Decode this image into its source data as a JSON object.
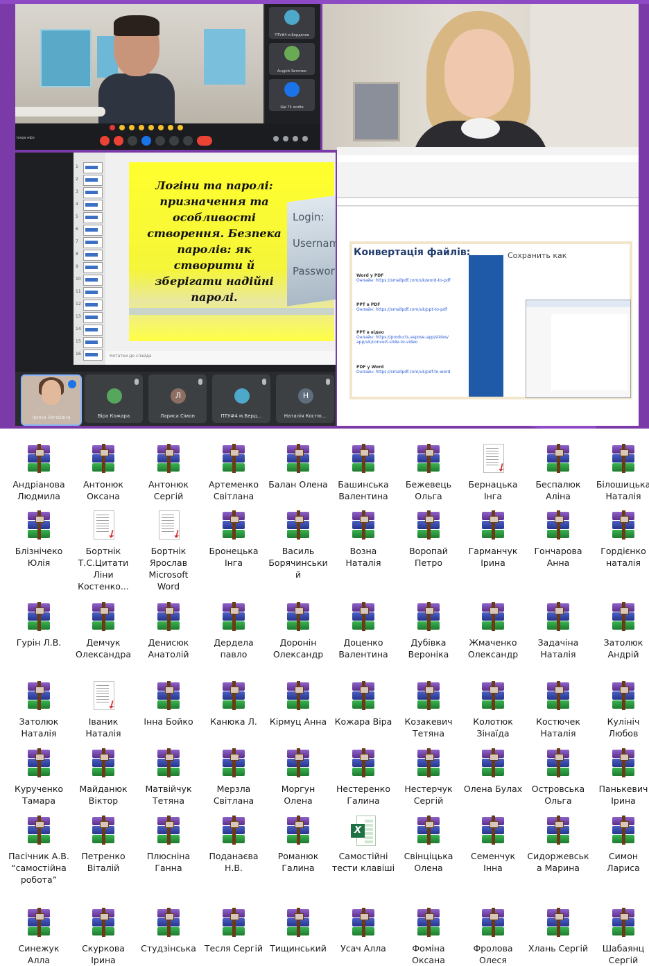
{
  "collage": {
    "video_call": {
      "thumbs": [
        {
          "label": "ПТУ#4 м.Бердичев",
          "color": "#4ea8c9"
        },
        {
          "label": "Андрій Затолюк",
          "color": "#6aaa55"
        },
        {
          "label": "Ще 74 особи",
          "color": "#1a73e8"
        }
      ],
      "meeting_label": "Іскра нфо",
      "emoji_count": 8
    },
    "slides": {
      "slide_text": "Логіни та паролі: призначення та особливості створення. Безпека паролів: як створити й зберігати надійні паролі.",
      "login_words": [
        "Login:",
        "Usernam",
        "Passwor"
      ],
      "notes_placeholder": "Нотатки до слайда",
      "thumb_numbers": [
        "1",
        "2",
        "3",
        "4",
        "5",
        "6",
        "7",
        "8",
        "9",
        "10",
        "11",
        "12",
        "13",
        "14",
        "15",
        "16"
      ],
      "participants": [
        {
          "name": "Ірина Нечаївна",
          "avatar": "",
          "color": "#c8b8ab",
          "self": true
        },
        {
          "name": "Віра Кожара",
          "avatar": "",
          "color": "#56a65e"
        },
        {
          "name": "Лариса Сімон",
          "avatar": "Л",
          "color": "#8d6e63"
        },
        {
          "name": "ПТУ#4 м.Берд...",
          "avatar": "",
          "color": "#4ea8c9"
        },
        {
          "name": "Наталія Костю...",
          "avatar": "Н",
          "color": "#5f6d7c"
        }
      ]
    },
    "document": {
      "slide_title": "Конвертація файлів:",
      "save_as_title": "Сохранить как",
      "items": [
        {
          "title": "Word у PDF",
          "link": "Онлайн: https://smallpdf.com/uk/word-to-pdf"
        },
        {
          "title": "PPT в PDF",
          "link": "Онлайн: https://smallpdf.com/uk/ppt-to-pdf"
        },
        {
          "title": "PPT в відео",
          "link": "Онлайн: https://products.aspose.app/slides/ app/uk/convert-slide-to-video"
        },
        {
          "title": "PDF у Word",
          "link": "Онлайн: https://smallpdf.com/uk/pdf-to-word"
        }
      ]
    }
  },
  "files": [
    {
      "name": "Андріанова Людмила",
      "type": "rar"
    },
    {
      "name": "Антонюк Оксана",
      "type": "rar"
    },
    {
      "name": "Антонюк Сергій",
      "type": "rar"
    },
    {
      "name": "Артеменко Світлана",
      "type": "rar"
    },
    {
      "name": "Балан Олена",
      "type": "rar"
    },
    {
      "name": "Башинська Валентина",
      "type": "rar"
    },
    {
      "name": "Бежевець Ольга",
      "type": "rar"
    },
    {
      "name": "Бернацька Інга",
      "type": "pdf"
    },
    {
      "name": "Беспалюк Аліна",
      "type": "rar"
    },
    {
      "name": "Білошицька Наталія",
      "type": "rar"
    },
    {
      "name": "Блізнічеко Юлія",
      "type": "rar"
    },
    {
      "name": "Бортнік Т.С.Цитати Ліни Костенко...",
      "type": "pdf"
    },
    {
      "name": "Бортнік Ярослав Microsoft Word",
      "type": "pdf"
    },
    {
      "name": "Бронецька Інга",
      "type": "rar"
    },
    {
      "name": "Василь Борячинський",
      "type": "rar"
    },
    {
      "name": "Возна Наталія",
      "type": "rar"
    },
    {
      "name": "Воропай Петро",
      "type": "rar"
    },
    {
      "name": "Гарманчук Ірина",
      "type": "rar"
    },
    {
      "name": "Гончарова Анна",
      "type": "rar"
    },
    {
      "name": "Гордієнко наталія",
      "type": "rar"
    },
    {
      "name": "Гурін Л.В.",
      "type": "rar"
    },
    {
      "name": "Демчук Олександра",
      "type": "rar"
    },
    {
      "name": "Денисюк Анатолій",
      "type": "rar"
    },
    {
      "name": "Дердела павло",
      "type": "rar"
    },
    {
      "name": "Доронін Олександр",
      "type": "rar"
    },
    {
      "name": "Доценко Валентина",
      "type": "rar"
    },
    {
      "name": "Дубівка Вероніка",
      "type": "rar"
    },
    {
      "name": "Жмаченко Олександр",
      "type": "rar"
    },
    {
      "name": "Задачіна Наталія",
      "type": "rar"
    },
    {
      "name": "Затолюк Андрій",
      "type": "rar"
    },
    {
      "name": "Затолюк Наталія",
      "type": "rar"
    },
    {
      "name": "Іваник Наталія",
      "type": "pdf"
    },
    {
      "name": "Інна Бойко",
      "type": "rar"
    },
    {
      "name": "Канюка Л.",
      "type": "rar"
    },
    {
      "name": "Кірмуц Анна",
      "type": "rar"
    },
    {
      "name": "Кожара Віра",
      "type": "rar"
    },
    {
      "name": "Козакевич Тетяна",
      "type": "rar"
    },
    {
      "name": "Колотюк Зінаїда",
      "type": "rar"
    },
    {
      "name": "Костючек Наталія",
      "type": "rar"
    },
    {
      "name": "Кулініч Любов",
      "type": "rar"
    },
    {
      "name": "Курученко Тамара",
      "type": "rar"
    },
    {
      "name": "Майданюк Віктор",
      "type": "rar"
    },
    {
      "name": "Матвійчук Тетяна",
      "type": "rar"
    },
    {
      "name": "Мерзла Світлана",
      "type": "rar"
    },
    {
      "name": "Моргун Олена",
      "type": "rar"
    },
    {
      "name": "Нестеренко Галина",
      "type": "rar"
    },
    {
      "name": "Нестерчук Сергій",
      "type": "rar"
    },
    {
      "name": "Олена Булах",
      "type": "rar"
    },
    {
      "name": "Островська Ольга",
      "type": "rar"
    },
    {
      "name": "Панькевич Ірина",
      "type": "rar"
    },
    {
      "name": "Пасічник А.В. “самостійна робота”",
      "type": "rar"
    },
    {
      "name": "Петренко Віталій",
      "type": "rar"
    },
    {
      "name": "Плюсніна Ганна",
      "type": "rar"
    },
    {
      "name": "Поданаєва Н.В.",
      "type": "rar"
    },
    {
      "name": "Романюк Галина",
      "type": "rar"
    },
    {
      "name": "Самостійні тести клавіші",
      "type": "xls"
    },
    {
      "name": "Свінціцька Олена",
      "type": "rar"
    },
    {
      "name": "Семенчук Інна",
      "type": "rar"
    },
    {
      "name": "Сидоржевська Марина",
      "type": "rar"
    },
    {
      "name": "Симон Лариса",
      "type": "rar"
    },
    {
      "name": "Синежук Алла",
      "type": "rar"
    },
    {
      "name": "Скуркова Ірина",
      "type": "rar"
    },
    {
      "name": "Студзінська",
      "type": "rar"
    },
    {
      "name": "Тесля Сергій",
      "type": "rar"
    },
    {
      "name": "Тищинський",
      "type": "rar"
    },
    {
      "name": "Усач Алла",
      "type": "rar"
    },
    {
      "name": "Фоміна Оксана",
      "type": "rar"
    },
    {
      "name": "Фролова Олеся",
      "type": "rar"
    },
    {
      "name": "Хлань Сергій",
      "type": "rar"
    },
    {
      "name": "Шабаянц Сергій",
      "type": "rar"
    }
  ]
}
